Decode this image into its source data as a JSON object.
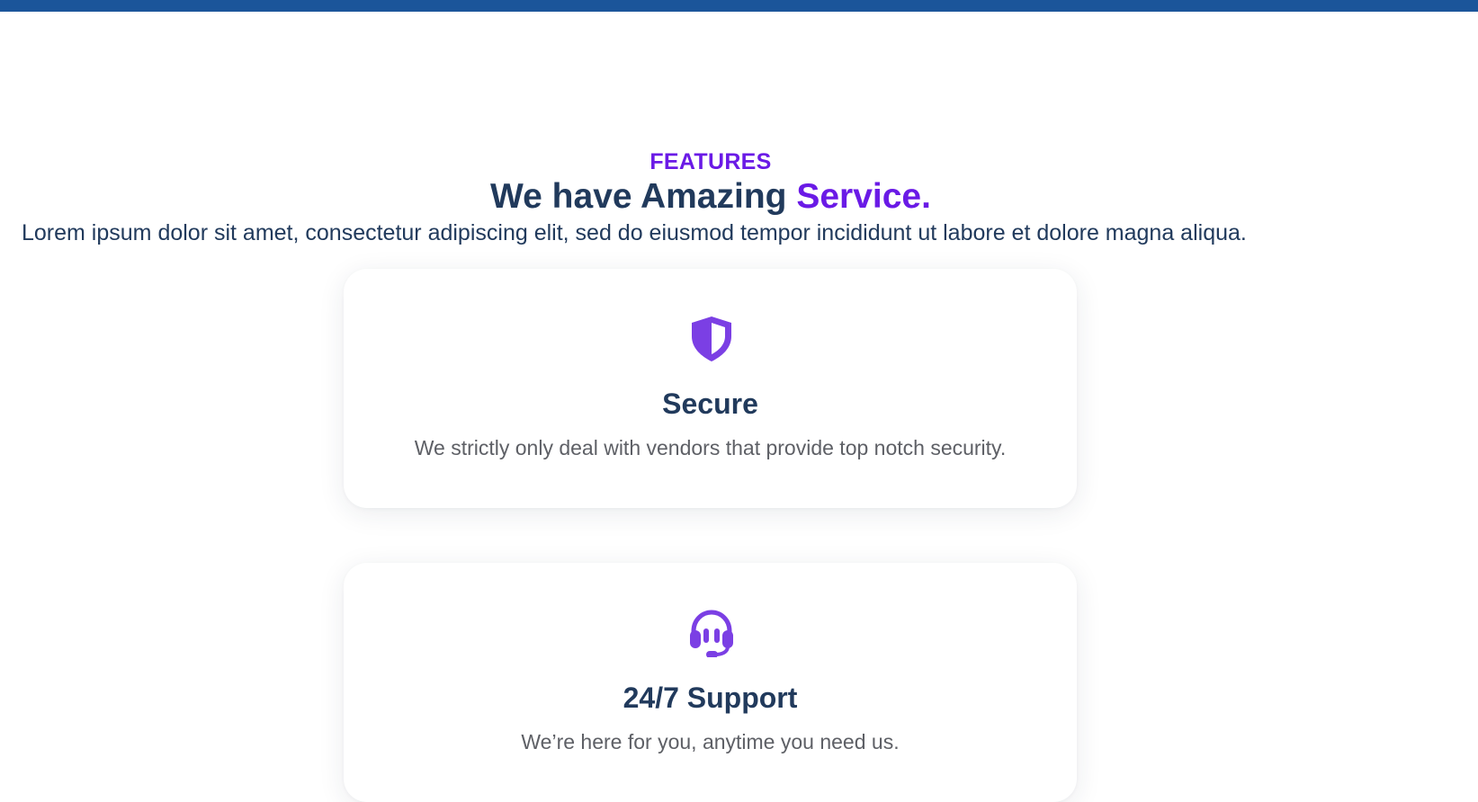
{
  "section": {
    "eyebrow": "FEATURES",
    "headline_main": "We have Amazing ",
    "headline_accent": "Service.",
    "intro": "Lorem ipsum dolor sit amet, consectetur adipiscing elit, sed do eiusmod tempor incididunt ut labore et dolore magna aliqua."
  },
  "cards": [
    {
      "icon": "shield-icon",
      "title": "Secure",
      "description": "We strictly only deal with vendors that provide top notch security."
    },
    {
      "icon": "headset-icon",
      "title": "24/7 Support",
      "description": "We’re here for you, anytime you need us."
    }
  ],
  "colors": {
    "top_bar": "#1b559a",
    "accent": "#6a1ae6",
    "heading": "#213a5c",
    "body_text": "#5e6066",
    "icon": "#7b3fe4"
  }
}
